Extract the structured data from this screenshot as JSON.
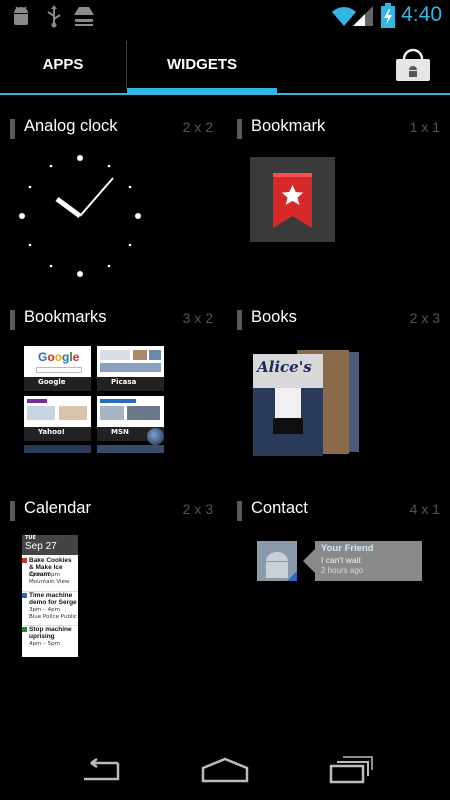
{
  "status": {
    "time": "4:40"
  },
  "tabs": {
    "apps": "APPS",
    "widgets": "WIDGETS"
  },
  "widgets": [
    {
      "title": "Analog clock",
      "size": "2 x 2"
    },
    {
      "title": "Bookmark",
      "size": "1 x 1"
    },
    {
      "title": "Bookmarks",
      "size": "3 x 2"
    },
    {
      "title": "Books",
      "size": "2 x 3"
    },
    {
      "title": "Calendar",
      "size": "2 x 3"
    },
    {
      "title": "Contact",
      "size": "4 x 1"
    }
  ],
  "bookmarks_preview": {
    "tiles": [
      "Google",
      "Picasa",
      "Yahoo!",
      "MSN"
    ]
  },
  "books_preview": {
    "cover_title": "Alice's"
  },
  "calendar_preview": {
    "day": "TUE",
    "date": "Sep 27",
    "events": [
      {
        "title": "Bake Cookies & Make Ice Cream",
        "time": "2pm – 3pm",
        "place": "Mountain View",
        "color": "#c0392b"
      },
      {
        "title": "Time machine demo for Serge",
        "time": "3pm – 4pm",
        "place": "Blue Police Public",
        "color": "#2a6cc0"
      },
      {
        "title": "Stop machine uprising",
        "time": "4pm – 5pm",
        "place": "",
        "color": "#2a8a2a"
      }
    ]
  },
  "contact_preview": {
    "name": "Your Friend",
    "status": "I can't wait",
    "ago": "2 hours ago"
  },
  "colors": {
    "accent": "#33b5e5",
    "background": "#000000"
  }
}
